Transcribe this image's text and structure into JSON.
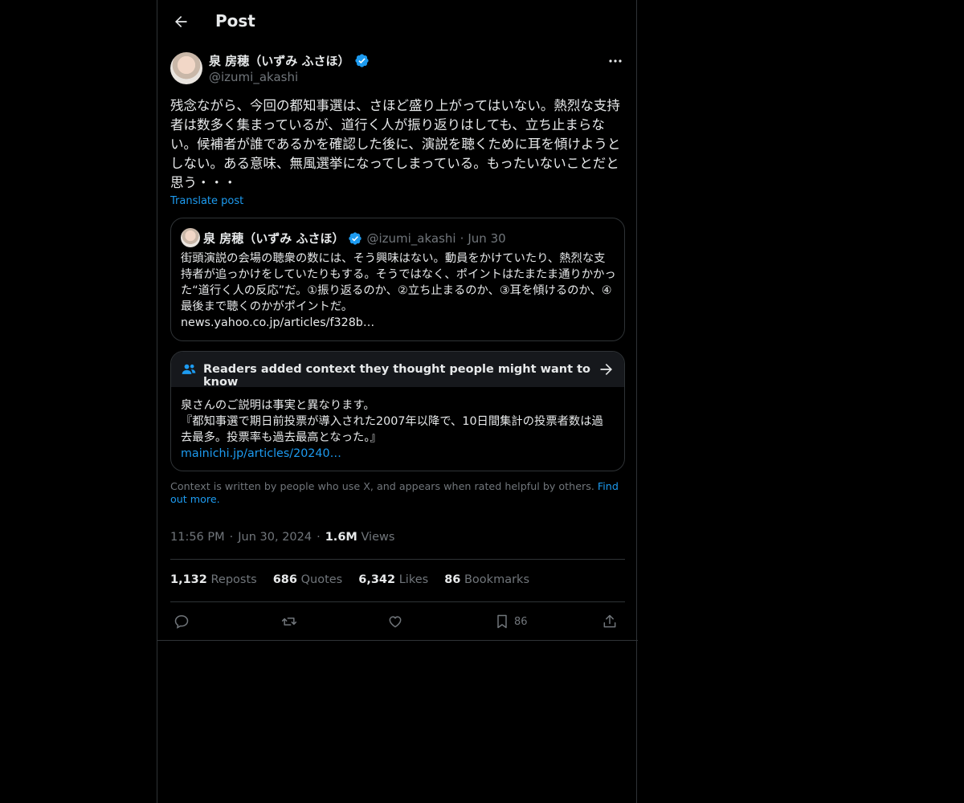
{
  "header": {
    "title": "Post"
  },
  "author": {
    "display_name": "泉 房穂（いずみ ふさほ）",
    "handle": "@izumi_akashi",
    "verified": true
  },
  "post": {
    "text": "残念ながら、今回の都知事選は、さほど盛り上がってはいない。熱烈な支持者は数多く集まっているが、道行く人が振り返りはしても、立ち止まらない。候補者が誰であるかを確認した後に、演説を聴くために耳を傾けようとしない。ある意味、無風選挙になってしまっている。もったいないことだと思う・・・",
    "translate_label": "Translate post"
  },
  "quote": {
    "display_name": "泉 房穂（いずみ ふさほ）",
    "handle": "@izumi_akashi",
    "separator": "·",
    "date": "Jun 30",
    "text": "街頭演説の会場の聴衆の数には、そう興味はない。動員をかけていたり、熱烈な支持者が追っかけをしていたりもする。そうではなく、ポイントはたまたま通りかかった“道行く人の反応”だ。①振り返るのか、②立ち止まるのか、③耳を傾けるのか、④最後まで聴くのかがポイントだ。\nnews.yahoo.co.jp/articles/f328b…"
  },
  "community_note": {
    "title": "Readers added context they thought people might want to know",
    "body": "泉さんのご説明は事実と異なります。\n『都知事選で期日前投票が導入された2007年以降で、10日間集計の投票者数は過去最多。投票率も過去最高となった。』",
    "link": "mainichi.jp/articles/20240…"
  },
  "context_note": {
    "text": "Context is written by people who use X, and appears when rated helpful by others.",
    "link": "Find out more."
  },
  "meta": {
    "time": "11:56 PM",
    "date": "Jun 30, 2024",
    "separator": "·",
    "views_count": "1.6M",
    "views_label": "Views"
  },
  "stats": {
    "reposts_count": "1,132",
    "reposts_label": "Reposts",
    "quotes_count": "686",
    "quotes_label": "Quotes",
    "likes_count": "6,342",
    "likes_label": "Likes",
    "bookmarks_count": "86",
    "bookmarks_label": "Bookmarks"
  },
  "actions": {
    "bookmark_count": "86"
  },
  "colors": {
    "background": "#000000",
    "text": "#e7e9ea",
    "secondary": "#71767b",
    "accent": "#1d9bf0",
    "border": "#2f3336"
  },
  "icons": [
    "back-arrow-icon",
    "verified-badge-icon",
    "more-icon",
    "people-icon",
    "arrow-right-icon",
    "reply-icon",
    "repost-icon",
    "like-icon",
    "bookmark-icon",
    "share-icon"
  ]
}
